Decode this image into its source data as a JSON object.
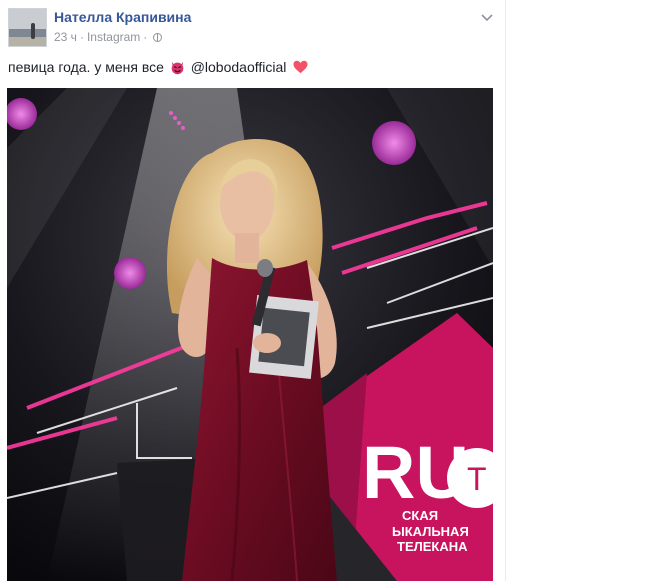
{
  "post": {
    "author_name": "Нателла Крапивина",
    "time": "23 ч",
    "meta_separator": "·",
    "source": "Instagram",
    "privacy_icon": "globe-icon",
    "menu_icon": "chevron-down-icon",
    "text_before_emoji": "певица года. у меня все",
    "mention": "@lobodaofficial",
    "emoji_1": "devil-emoji-icon",
    "emoji_2": "heart-emoji-icon"
  },
  "photo": {
    "stage_text_lines": [
      "RU",
      "T",
      "СКАЯ",
      "ЫКАЛЬНАЯ",
      "ТЕЛЕКАНА"
    ]
  },
  "colors": {
    "author_link": "#365899",
    "meta_gray": "#90949c",
    "heart": "#f25268",
    "dress": "#7a0f27",
    "stage_pink": "#d41d6d"
  }
}
